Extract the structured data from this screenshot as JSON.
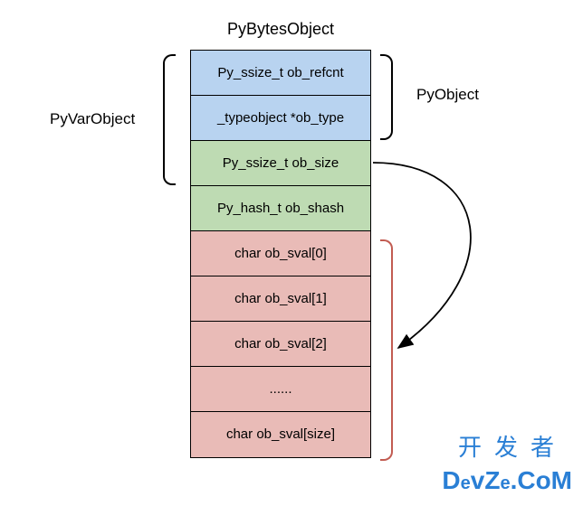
{
  "title": "PyBytesObject",
  "labels": {
    "pyvarobject": "PyVarObject",
    "pyobject": "PyObject"
  },
  "cells": [
    {
      "text": "Py_ssize_t ob_refcnt",
      "cls": "blue"
    },
    {
      "text": "_typeobject *ob_type",
      "cls": "blue"
    },
    {
      "text": "Py_ssize_t ob_size",
      "cls": "green"
    },
    {
      "text": "Py_hash_t ob_shash",
      "cls": "green"
    },
    {
      "text": "char ob_sval[0]",
      "cls": "red"
    },
    {
      "text": "char ob_sval[1]",
      "cls": "red"
    },
    {
      "text": "char ob_sval[2]",
      "cls": "red"
    },
    {
      "text": "......",
      "cls": "red"
    },
    {
      "text": "char ob_sval[size]",
      "cls": "red"
    }
  ],
  "watermark": {
    "line1": "开发者",
    "line2_pre": "D",
    "line2_e1": "e",
    "line2_mid": "vZ",
    "line2_e2": "e",
    "line2_post": ".CoM"
  },
  "chart_data": {
    "type": "table",
    "title": "PyBytesObject memory layout",
    "fields": [
      {
        "name": "ob_refcnt",
        "type": "Py_ssize_t",
        "group": "PyObject"
      },
      {
        "name": "ob_type",
        "type": "_typeobject *",
        "group": "PyObject"
      },
      {
        "name": "ob_size",
        "type": "Py_ssize_t",
        "group": "PyVarObject"
      },
      {
        "name": "ob_shash",
        "type": "Py_hash_t",
        "group": "PyBytesObject"
      },
      {
        "name": "ob_sval",
        "type": "char[]",
        "indices": [
          "0",
          "1",
          "2",
          "...",
          "size"
        ],
        "group": "PyBytesObject"
      }
    ],
    "relations": [
      {
        "from": "ob_size",
        "to": "ob_sval",
        "meaning": "ob_size gives length of ob_sval array"
      }
    ],
    "braces": [
      {
        "side": "left",
        "label": "PyVarObject",
        "covers": [
          "ob_refcnt",
          "ob_type",
          "ob_size"
        ]
      },
      {
        "side": "right",
        "label": "PyObject",
        "covers": [
          "ob_refcnt",
          "ob_type"
        ]
      },
      {
        "side": "right",
        "label": "",
        "covers": [
          "ob_sval[0]",
          "ob_sval[1]",
          "ob_sval[2]",
          "...",
          "ob_sval[size]"
        ]
      }
    ]
  }
}
